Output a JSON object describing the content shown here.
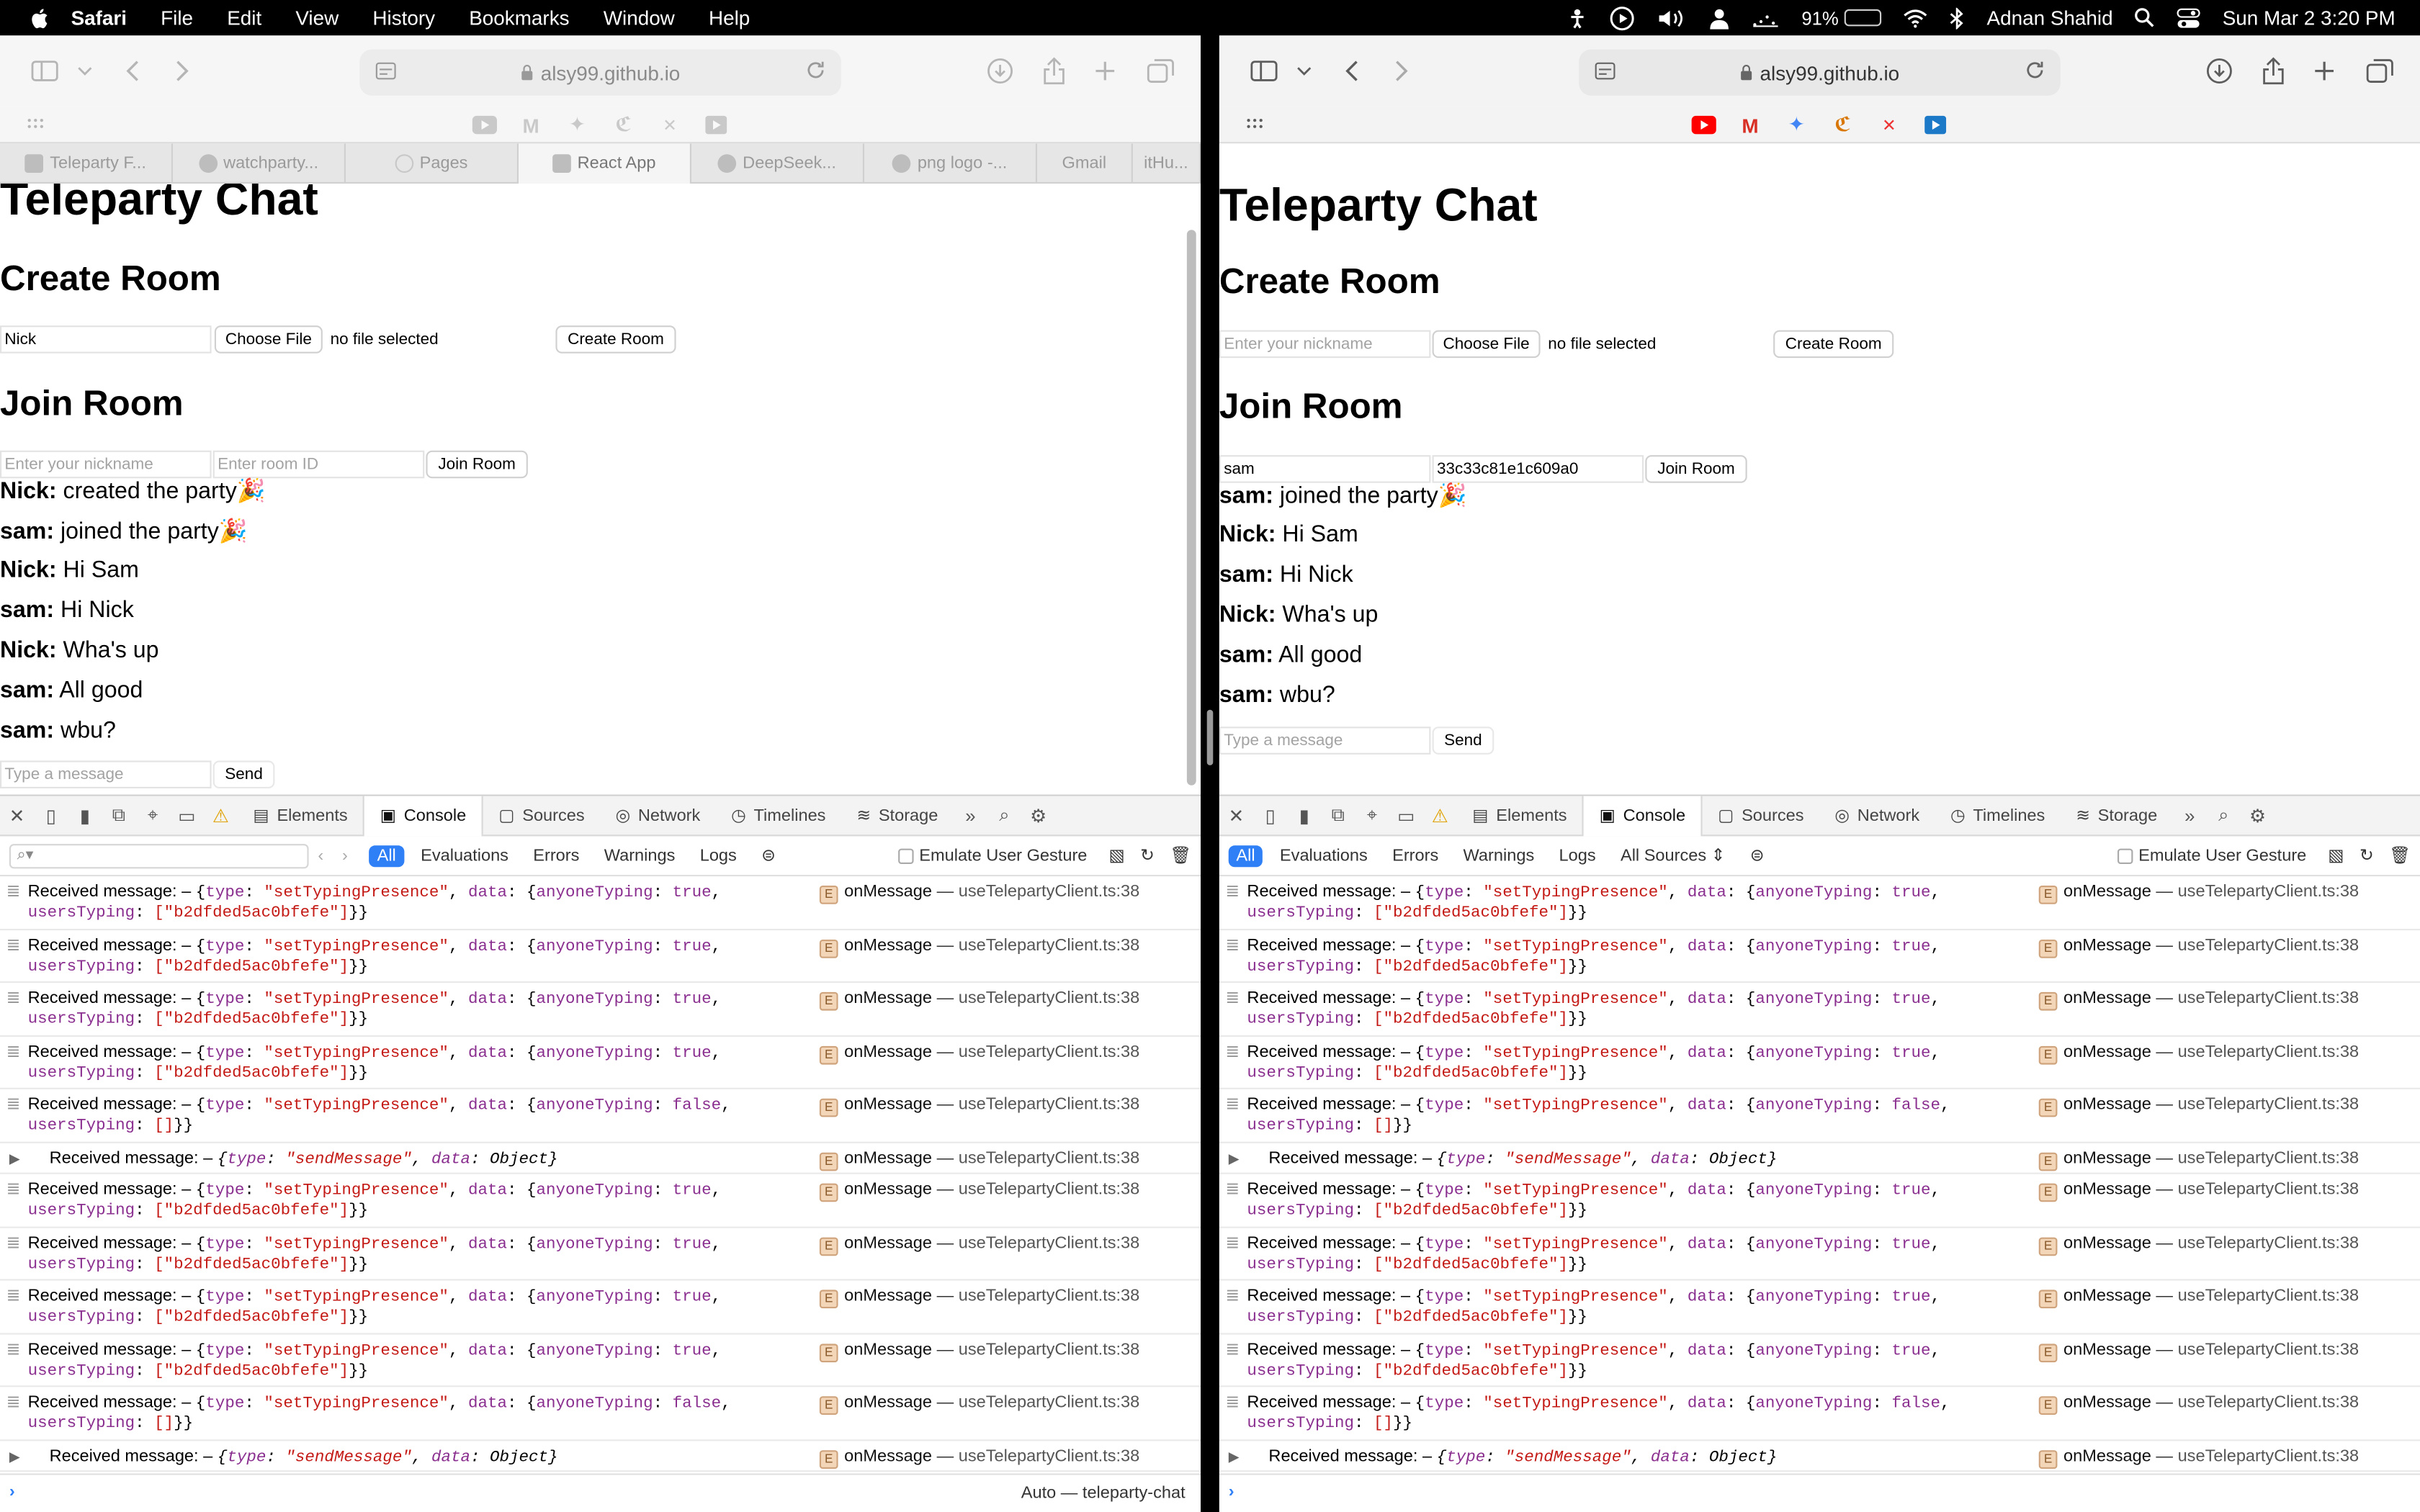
{
  "menubar": {
    "app": "Safari",
    "items": [
      "File",
      "Edit",
      "View",
      "History",
      "Bookmarks",
      "Window",
      "Help"
    ],
    "battery": "91%",
    "user": "Adnan Shahid",
    "datetime": "Sun Mar 2  3:20 PM",
    "battery_color": "#ffd60a"
  },
  "left": {
    "url": "alsy99.github.io",
    "tabs": [
      "Teleparty F...",
      "watchparty...",
      "Pages",
      "React App",
      "DeepSeek...",
      "png logo -...",
      "Gmail",
      "itHu..."
    ],
    "page": {
      "title": "Teleparty Chat",
      "create_heading": "Create Room",
      "create_nickname": "Nick",
      "choose_file": "Choose File",
      "no_file": "no file selected",
      "create_button": "Create Room",
      "join_heading": "Join Room",
      "join_nickname_placeholder": "Enter your nickname",
      "join_room_placeholder": "Enter room ID",
      "join_button": "Join Room",
      "messages": [
        {
          "user": "Nick:",
          "text": " created the party🎉"
        },
        {
          "user": "sam:",
          "text": " joined the party🎉"
        },
        {
          "user": "Nick:",
          "text": " Hi Sam"
        },
        {
          "user": "sam:",
          "text": " Hi Nick"
        },
        {
          "user": "Nick:",
          "text": " Wha's up"
        },
        {
          "user": "sam:",
          "text": " All good"
        },
        {
          "user": "sam:",
          "text": " wbu?"
        }
      ],
      "message_placeholder": "Type a message",
      "send": "Send"
    },
    "footer_context": "Auto — teleparty-chat"
  },
  "right": {
    "url": "alsy99.github.io",
    "page": {
      "title": "Teleparty Chat",
      "create_heading": "Create Room",
      "create_nickname_placeholder": "Enter your nickname",
      "choose_file": "Choose File",
      "no_file": "no file selected",
      "create_button": "Create Room",
      "join_heading": "Join Room",
      "join_nickname": "sam",
      "join_room_id": "33c33c81e1c609a0",
      "join_button": "Join Room",
      "messages": [
        {
          "user": "sam:",
          "text": " joined the party🎉"
        },
        {
          "user": "Nick:",
          "text": " Hi Sam"
        },
        {
          "user": "sam:",
          "text": " Hi Nick"
        },
        {
          "user": "Nick:",
          "text": " Wha's up"
        },
        {
          "user": "sam:",
          "text": " All good"
        },
        {
          "user": "sam:",
          "text": " wbu?"
        }
      ],
      "message_placeholder": "Type a message",
      "send": "Send"
    },
    "all_sources": "All Sources"
  },
  "devtools": {
    "tabs": [
      "Elements",
      "Console",
      "Sources",
      "Network",
      "Timelines",
      "Storage"
    ],
    "filters": [
      "All",
      "Evaluations",
      "Errors",
      "Warnings",
      "Logs"
    ],
    "emulate": "Emulate User Gesture",
    "log_prefix": "Received message:",
    "log_source_fn": "onMessage",
    "log_source_file": "useTelepartyClient.ts:38",
    "logs": [
      {
        "kind": "typing",
        "anyone": "true",
        "users": "[\"b2dfded5ac0bfefe\"]"
      },
      {
        "kind": "typing",
        "anyone": "true",
        "users": "[\"b2dfded5ac0bfefe\"]"
      },
      {
        "kind": "typing",
        "anyone": "true",
        "users": "[\"b2dfded5ac0bfefe\"]"
      },
      {
        "kind": "typing",
        "anyone": "true",
        "users": "[\"b2dfded5ac0bfefe\"]"
      },
      {
        "kind": "typing",
        "anyone": "false",
        "users": "[]"
      },
      {
        "kind": "send"
      },
      {
        "kind": "typing",
        "anyone": "true",
        "users": "[\"b2dfded5ac0bfefe\"]"
      },
      {
        "kind": "typing",
        "anyone": "true",
        "users": "[\"b2dfded5ac0bfefe\"]"
      },
      {
        "kind": "typing",
        "anyone": "true",
        "users": "[\"b2dfded5ac0bfefe\"]"
      },
      {
        "kind": "typing",
        "anyone": "true",
        "users": "[\"b2dfded5ac0bfefe\"]"
      },
      {
        "kind": "typing",
        "anyone": "false",
        "users": "[]"
      },
      {
        "kind": "send"
      }
    ],
    "typing_type": "\"setTypingPresence\"",
    "send_type": "\"sendMessage\""
  }
}
